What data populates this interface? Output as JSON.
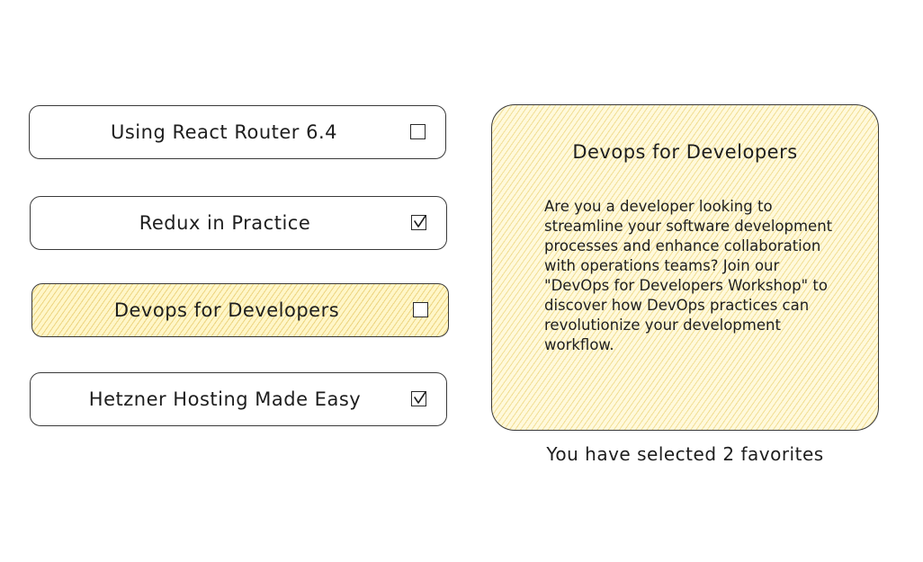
{
  "list": {
    "items": [
      {
        "label": "Using React Router 6.4",
        "checked": false,
        "selected": false
      },
      {
        "label": "Redux in Practice",
        "checked": true,
        "selected": false
      },
      {
        "label": "Devops for Developers",
        "checked": false,
        "selected": true
      },
      {
        "label": "Hetzner Hosting Made Easy",
        "checked": true,
        "selected": false
      }
    ]
  },
  "detail": {
    "title": "Devops for Developers",
    "description": "Are you a developer looking to streamline your software development processes and enhance collaboration with operations teams? Join our \"DevOps for Developers Workshop\" to discover how DevOps practices can revolutionize your development workflow."
  },
  "summary": {
    "text": "You have selected 2 favorites"
  },
  "colors": {
    "stroke": "#1e1e1e",
    "highlight_fill": "#fff6c8",
    "hatch": "#e1be50"
  }
}
